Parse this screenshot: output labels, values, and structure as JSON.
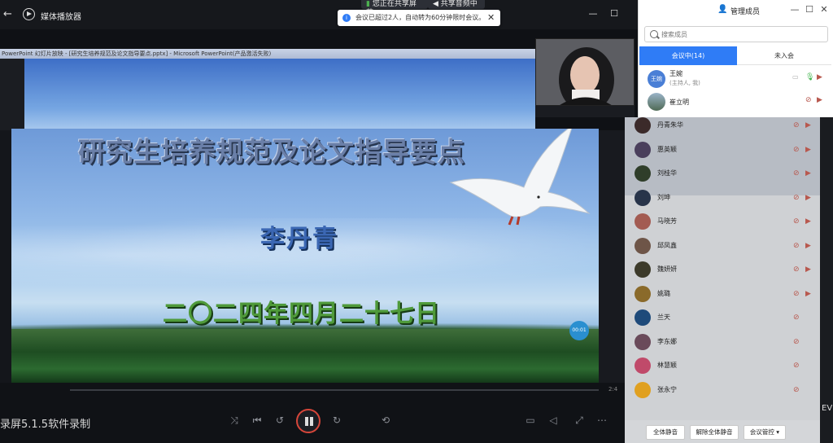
{
  "player": {
    "title": "媒体播放器",
    "back_glyph": "←",
    "minimize_glyph": "—",
    "maximize_glyph": "☐"
  },
  "share": {
    "sharing_label": "您正在共享屏幕",
    "audio_label": "共享音频中"
  },
  "toast": {
    "text": "会议已超过2人，自动转为60分钟限时会议。",
    "close_glyph": "✕",
    "info_glyph": "i"
  },
  "ppt": {
    "window_title": "PowerPoint 幻灯片放映 - [研究生培养规范及论文指导要点.pptx] - Microsoft PowerPoint(产品激活失败)"
  },
  "slide": {
    "title": "研究生培养规范及论文指导要点",
    "author": "李丹青",
    "date": "二〇二四年四月二十七日",
    "timer": "00:01"
  },
  "recorder": {
    "watermark": "录屏5.1.5软件录制",
    "time": "2:4"
  },
  "panel": {
    "title": "管理成员",
    "minimize_glyph": "—",
    "maximize_glyph": "☐",
    "close_glyph": "✕",
    "search_placeholder": "搜索成员",
    "tab_in_meeting": "会议中(14)",
    "tab_not_joined": "未入会",
    "host": {
      "avatar_text": "王婉",
      "name": "王婉",
      "role": "(主持人, 我)"
    },
    "members": [
      {
        "name": "崔立明"
      },
      {
        "name": "丹青朱华"
      },
      {
        "name": "惠英颖"
      },
      {
        "name": "刘桂华"
      },
      {
        "name": "刘坤"
      },
      {
        "name": "马晓芳"
      },
      {
        "name": "邱凤鑫"
      },
      {
        "name": "魏妍妍"
      },
      {
        "name": "姚璐"
      },
      {
        "name": "兰天"
      },
      {
        "name": "李东娜"
      },
      {
        "name": "林慧颖"
      },
      {
        "name": "张永宁"
      }
    ],
    "btn_mute_all": "全体静音",
    "btn_unmute_all": "解除全体静音",
    "btn_control": "会议管控 ▾"
  },
  "edge": {
    "right_text": "EV"
  },
  "colors": {
    "accent": "#2f7cf6",
    "muted_red": "#b8584e"
  }
}
